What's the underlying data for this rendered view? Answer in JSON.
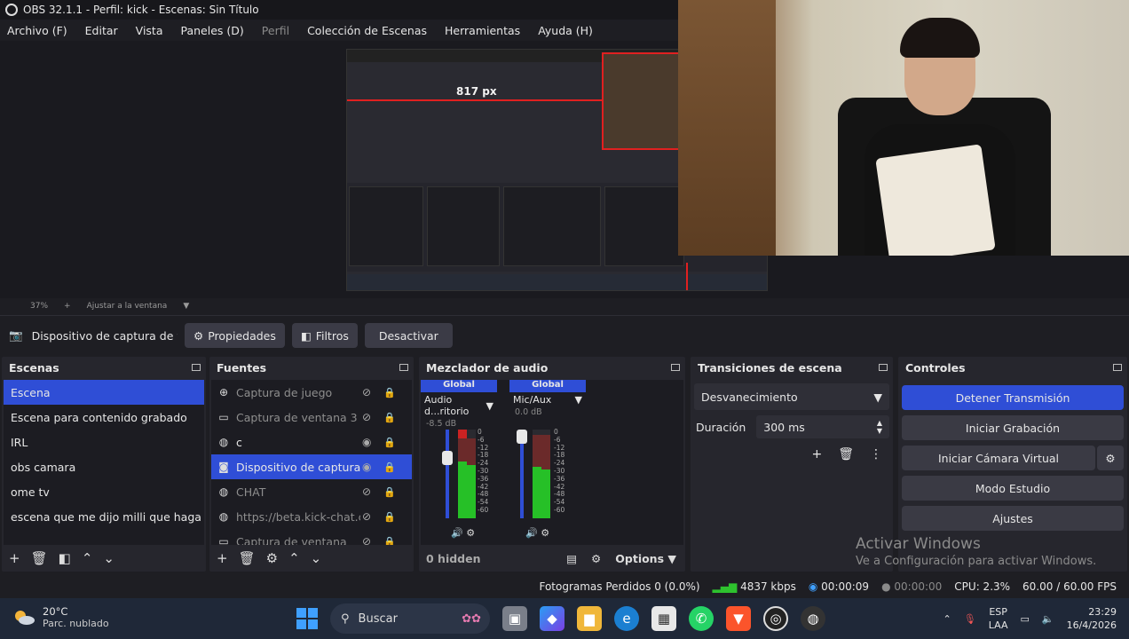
{
  "window": {
    "title": "OBS 32.1.1 - Perfil: kick - Escenas: Sin Título"
  },
  "menu": [
    "Archivo (F)",
    "Editar",
    "Vista",
    "Paneles (D)",
    "Perfil",
    "Colección de Escenas",
    "Herramientas",
    "Ayuda (H)"
  ],
  "preview": {
    "measure_label": "817 px"
  },
  "zoom": {
    "value": "37%",
    "fit": "Ajustar a la ventana"
  },
  "context": {
    "source": "Dispositivo de captura de v",
    "properties": "Propiedades",
    "filters": "Filtros",
    "deactivate": "Desactivar"
  },
  "scenes": {
    "title": "Escenas",
    "items": [
      "Escena",
      "Escena para contenido grabado",
      "IRL",
      "obs camara",
      "ome tv",
      "escena que me dijo milli que haga para p"
    ],
    "selected": 0
  },
  "sources": {
    "title": "Fuentes",
    "items": [
      {
        "label": "Captura de juego",
        "icon": "gamepad-icon",
        "visible": false
      },
      {
        "label": "Captura de ventana 3",
        "icon": "window-icon",
        "visible": false
      },
      {
        "label": "c",
        "icon": "browser-icon",
        "visible": true
      },
      {
        "label": "Dispositivo de captura d",
        "icon": "camera-icon",
        "visible": true
      },
      {
        "label": "CHAT",
        "icon": "browser-icon",
        "visible": false
      },
      {
        "label": "https://beta.kick-chat.co",
        "icon": "browser-icon",
        "visible": false
      },
      {
        "label": "Captura de ventana",
        "icon": "window-icon",
        "visible": false
      }
    ],
    "selected": 3
  },
  "mixer": {
    "title": "Mezclador de audio",
    "channels": [
      {
        "tag": "Global",
        "name": "Audio d...ritorio",
        "db": "-8.5 dB"
      },
      {
        "tag": "Global",
        "name": "Mic/Aux",
        "db": "0.0 dB"
      }
    ],
    "scale": [
      "0",
      "-6",
      "-12",
      "-18",
      "-24",
      "-30",
      "-36",
      "-42",
      "-48",
      "-54",
      "-60"
    ],
    "hidden": "0 hidden",
    "options": "Options"
  },
  "transitions": {
    "title": "Transiciones de escena",
    "type": "Desvanecimiento",
    "duration_label": "Duración",
    "duration": "300 ms"
  },
  "controls": {
    "title": "Controles",
    "stop_stream": "Detener Transmisión",
    "start_recording": "Iniciar Grabación",
    "virtual_camera": "Iniciar Cámara Virtual",
    "studio_mode": "Modo Estudio",
    "settings": "Ajustes"
  },
  "watermark": {
    "line1": "Activar Windows",
    "line2": "Ve a Configuración para activar Windows."
  },
  "status": {
    "dropped": "Fotogramas Perdidos 0 (0.0%)",
    "bitrate": "4837 kbps",
    "stream_time": "00:00:09",
    "rec_time": "00:00:00",
    "cpu": "CPU: 2.3%",
    "fps": "60.00 / 60.00 FPS"
  },
  "taskbar": {
    "temp": "20°C",
    "weather": "Parc. nublado",
    "search": "Buscar",
    "lang1": "ESP",
    "lang2": "LAA",
    "time": "23:29",
    "date": "16/4/2026"
  },
  "colors": {
    "accent": "#2f4ed6",
    "panel": "#26262d",
    "red": "#e02020",
    "meter_green": "#26c027"
  }
}
